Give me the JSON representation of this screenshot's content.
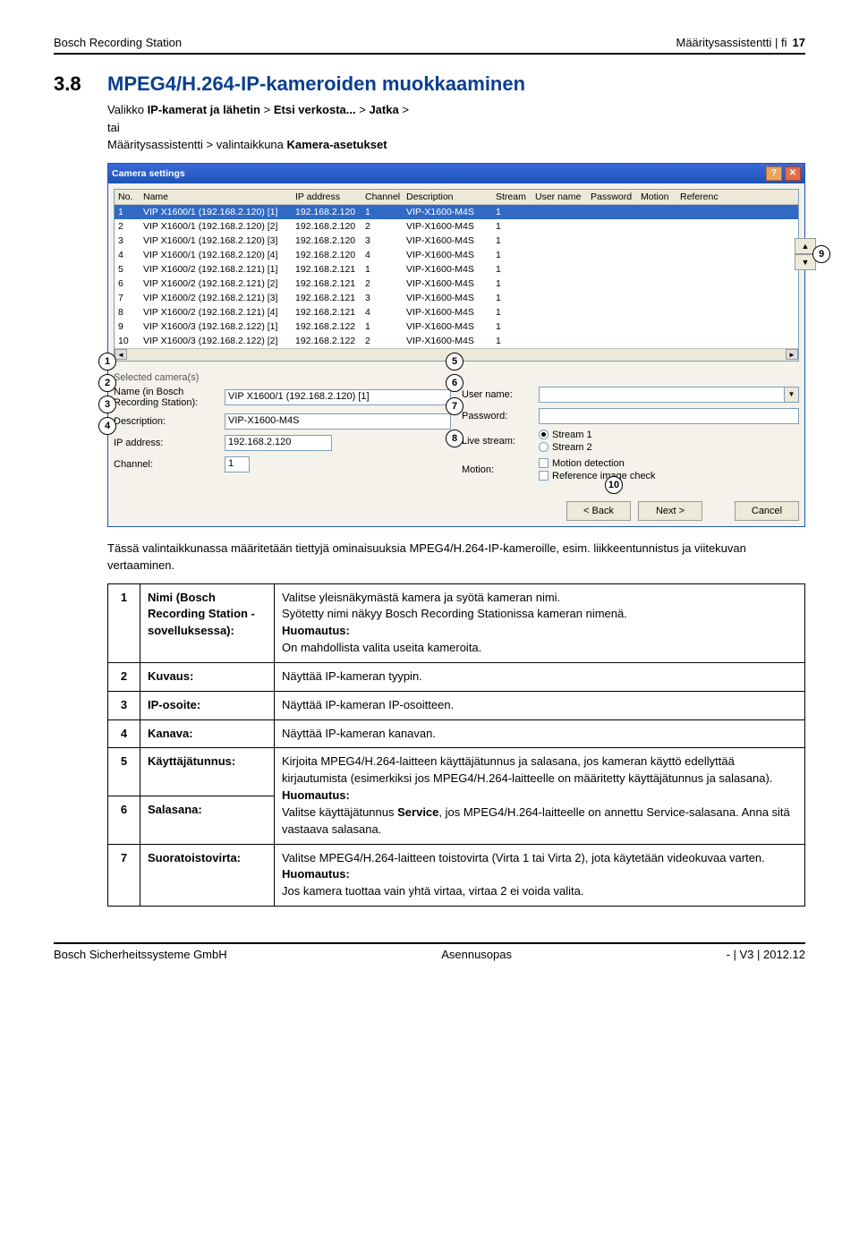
{
  "header": {
    "left": "Bosch Recording Station",
    "mid": "Määritysassistentti | fi",
    "page": "17"
  },
  "section": {
    "num": "3.8",
    "title": "MPEG4/H.264-IP-kameroiden muokkaaminen"
  },
  "intro": {
    "l1a": "Valikko ",
    "l1b": "IP-kamerat ja lähetin",
    "l1c": " > ",
    "l1d": "Etsi verkosta...",
    "l1e": " > ",
    "l1f": "Jatka",
    "l1g": " >",
    "l2": "tai",
    "l3a": "Määritysassistentti > valintaikkuna ",
    "l3b": "Kamera-asetukset"
  },
  "win": {
    "title": "Camera settings",
    "cols": {
      "no": "No.",
      "name": "Name",
      "ip": "IP address",
      "ch": "Channel",
      "desc": "Description",
      "st": "Stream",
      "un": "User name",
      "pw": "Password",
      "mo": "Motion",
      "rf": "Referenc"
    },
    "rows": [
      {
        "no": "1",
        "nm": "VIP X1600/1 (192.168.2.120) [1]",
        "ip": "192.168.2.120",
        "ch": "1",
        "dsc": "VIP-X1600-M4S",
        "st": "1"
      },
      {
        "no": "2",
        "nm": "VIP X1600/1 (192.168.2.120) [2]",
        "ip": "192.168.2.120",
        "ch": "2",
        "dsc": "VIP-X1600-M4S",
        "st": "1"
      },
      {
        "no": "3",
        "nm": "VIP X1600/1 (192.168.2.120) [3]",
        "ip": "192.168.2.120",
        "ch": "3",
        "dsc": "VIP-X1600-M4S",
        "st": "1"
      },
      {
        "no": "4",
        "nm": "VIP X1600/1 (192.168.2.120) [4]",
        "ip": "192.168.2.120",
        "ch": "4",
        "dsc": "VIP-X1600-M4S",
        "st": "1"
      },
      {
        "no": "5",
        "nm": "VIP X1600/2 (192.168.2.121) [1]",
        "ip": "192.168.2.121",
        "ch": "1",
        "dsc": "VIP-X1600-M4S",
        "st": "1"
      },
      {
        "no": "6",
        "nm": "VIP X1600/2 (192.168.2.121) [2]",
        "ip": "192.168.2.121",
        "ch": "2",
        "dsc": "VIP-X1600-M4S",
        "st": "1"
      },
      {
        "no": "7",
        "nm": "VIP X1600/2 (192.168.2.121) [3]",
        "ip": "192.168.2.121",
        "ch": "3",
        "dsc": "VIP-X1600-M4S",
        "st": "1"
      },
      {
        "no": "8",
        "nm": "VIP X1600/2 (192.168.2.121) [4]",
        "ip": "192.168.2.121",
        "ch": "4",
        "dsc": "VIP-X1600-M4S",
        "st": "1"
      },
      {
        "no": "9",
        "nm": "VIP X1600/3 (192.168.2.122) [1]",
        "ip": "192.168.2.122",
        "ch": "1",
        "dsc": "VIP-X1600-M4S",
        "st": "1"
      },
      {
        "no": "10",
        "nm": "VIP X1600/3 (192.168.2.122) [2]",
        "ip": "192.168.2.122",
        "ch": "2",
        "dsc": "VIP-X1600-M4S",
        "st": "1"
      }
    ],
    "selhdr": "Selected camera(s)",
    "labs": {
      "name": "Name (in Bosch Recording Station):",
      "desc": "Description:",
      "ip": "IP address:",
      "ch": "Channel:",
      "un": "User name:",
      "pw": "Password:",
      "ls": "Live stream:",
      "mo": "Motion:"
    },
    "vals": {
      "name": "VIP X1600/1 (192.168.2.120) [1]",
      "desc": "VIP-X1600-M4S",
      "ip": "192.168.2.120",
      "ch": "1"
    },
    "opts": {
      "s1": "Stream 1",
      "s2": "Stream 2",
      "md": "Motion detection",
      "ric": "Reference image check"
    },
    "btns": {
      "back": "< Back",
      "next": "Next >",
      "cancel": "Cancel"
    }
  },
  "callouts": {
    "c1": "1",
    "c2": "2",
    "c3": "3",
    "c4": "4",
    "c5": "5",
    "c6": "6",
    "c7": "7",
    "c8": "8",
    "c9": "9",
    "c10": "10"
  },
  "after": "Tässä valintaikkunassa määritetään tiettyjä ominaisuuksia MPEG4/H.264-IP-kameroille, esim. liikkeentunnistus ja viitekuvan vertaaminen.",
  "defs": [
    {
      "n": "1",
      "t": "Nimi (Bosch Recording Station -sovelluksessa):",
      "d": "Valitse yleisnäkymästä kamera ja syötä kameran nimi.\nSyötetty nimi näkyy Bosch Recording Stationissa kameran nimenä.\nHuomautus:\nOn mahdollista valita useita kameroita."
    },
    {
      "n": "2",
      "t": "Kuvaus:",
      "d": "Näyttää IP-kameran tyypin."
    },
    {
      "n": "3",
      "t": "IP-osoite:",
      "d": "Näyttää IP-kameran IP-osoitteen."
    },
    {
      "n": "4",
      "t": "Kanava:",
      "d": "Näyttää IP-kameran kanavan."
    },
    {
      "n": "5",
      "t": "Käyttäjätunnus:",
      "d": "Kirjoita MPEG4/H.264-laitteen käyttäjätunnus ja salasana, jos kameran käyttö edellyttää kirjautumista (esimerkiksi jos MPEG4/H.264-laitteelle on määritetty käyttäjätunnus ja salasana).\nHuomautus:\nValitse käyttäjätunnus Service, jos MPEG4/H.264-laitteelle on annettu Service-salasana. Anna sitä vastaava salasana.",
      "mergeNext": true
    },
    {
      "n": "6",
      "t": "Salasana:"
    },
    {
      "n": "7",
      "t": "Suoratoistovirta:",
      "d": "Valitse MPEG4/H.264-laitteen toistovirta (Virta 1 tai Virta 2), jota käytetään videokuvaa varten.\nHuomautus:\nJos kamera tuottaa vain yhtä virtaa, virtaa 2 ei voida valita."
    }
  ],
  "notebold": {
    "h": "Huomautus:",
    "s": "Service"
  },
  "footer": {
    "left": "Bosch Sicherheitssysteme GmbH",
    "mid": "Asennusopas",
    "right": "- | V3 | 2012.12"
  }
}
